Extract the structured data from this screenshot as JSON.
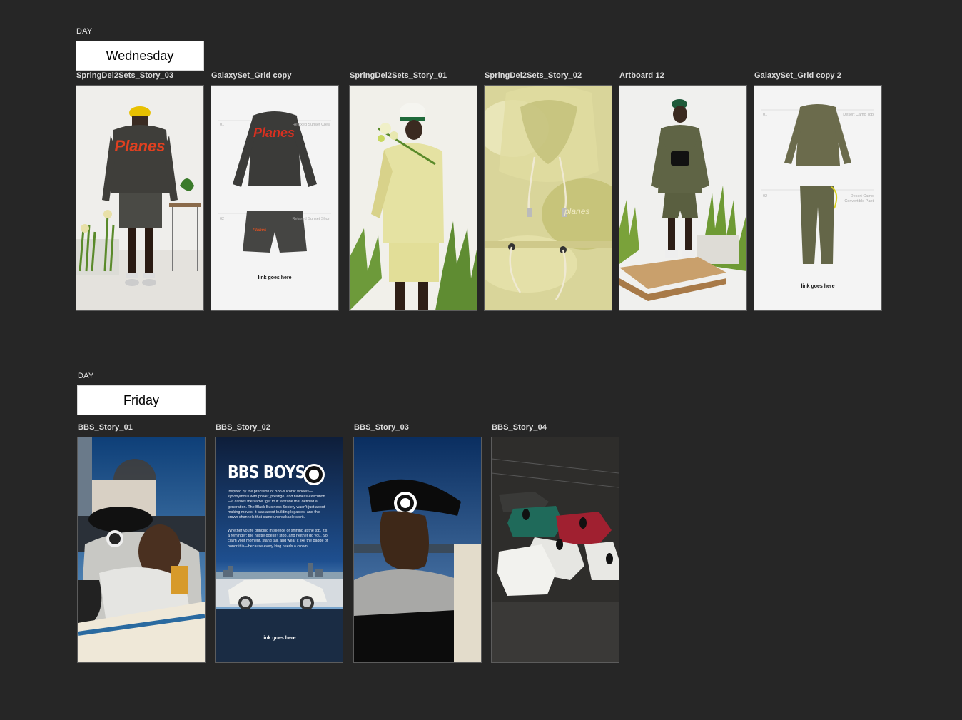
{
  "sections": [
    {
      "day_label": "DAY",
      "day": "Wednesday",
      "frames": [
        {
          "title": "SpringDel2Sets_Story_03"
        },
        {
          "title": "GalaxySet_Grid copy",
          "item1": "Relaxed Sunset Crew",
          "item2": "Relaxed Sunset Short",
          "num1": "01",
          "num2": "02",
          "link": "link goes here"
        },
        {
          "title": "SpringDel2Sets_Story_01"
        },
        {
          "title": "SpringDel2Sets_Story_02"
        },
        {
          "title": "Artboard 12"
        },
        {
          "title": "GalaxySet_Grid copy 2",
          "item1": "Desert Camo Top",
          "item2": "Desert Camo Convertible Pant",
          "num1": "01",
          "num2": "02",
          "link": "link goes here"
        }
      ]
    },
    {
      "day_label": "DAY",
      "day": "Friday",
      "frames": [
        {
          "title": "BBS_Story_01"
        },
        {
          "title": "BBS_Story_02",
          "heading": "BBS BOYS",
          "para1": "Inspired by the precision of BBS's iconic wheels—synonymous with power, prestige, and flawless execution—it carries the same \"get to it\" attitude that defined a generation. The Black Business Society wasn't just about making moves; it was about building legacies, and this crown channels that same unbreakable spirit.",
          "para2": "Whether you're grinding in silence or shining at the top, it's a reminder: the hustle doesn't stop, and neither do you. So claim your moment, stand tall, and wear it like the badge of honor it is—because every king needs a crown.",
          "link": "link goes here"
        },
        {
          "title": "BBS_Story_03"
        },
        {
          "title": "BBS_Story_04"
        }
      ]
    }
  ],
  "brand_text": "Planes",
  "colors": {
    "canvas": "#262626",
    "label": "#e6e6e6",
    "day_box": "#ffffff"
  }
}
